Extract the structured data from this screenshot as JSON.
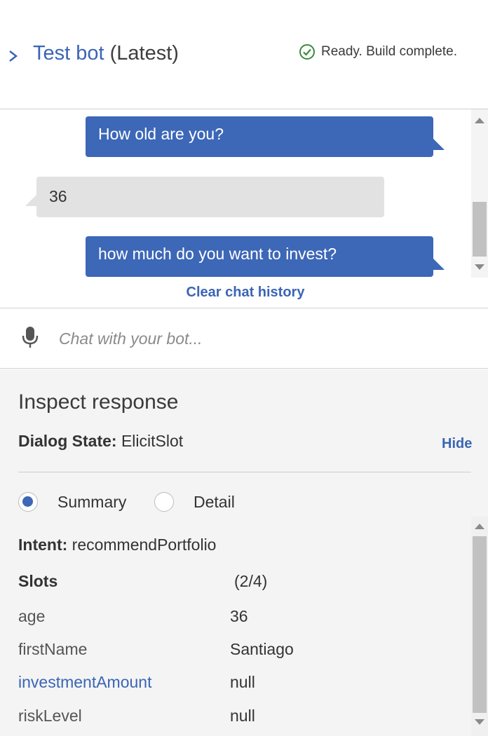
{
  "header": {
    "title_link": "Test bot",
    "title_suffix": "(Latest)",
    "status": "Ready. Build complete.",
    "status_color": "#3c8a3c"
  },
  "chat": {
    "messages": [
      {
        "from": "bot",
        "text": "How old are you?"
      },
      {
        "from": "user",
        "text": "36"
      },
      {
        "from": "bot",
        "text": "how much do you want to invest?"
      }
    ],
    "clear_label": "Clear chat history"
  },
  "input": {
    "placeholder": "Chat with your bot...",
    "icon": "microphone-icon"
  },
  "inspect": {
    "title": "Inspect response",
    "dialog_state_label": "Dialog State:",
    "dialog_state_value": "ElicitSlot",
    "hide_label": "Hide",
    "view_options": [
      {
        "label": "Summary",
        "selected": true
      },
      {
        "label": "Detail",
        "selected": false
      }
    ],
    "intent_label": "Intent:",
    "intent_value": "recommendPortfolio",
    "slots_label": "Slots",
    "slots_count": "(2/4)",
    "slots": [
      {
        "name": "age",
        "value": "36"
      },
      {
        "name": "firstName",
        "value": "Santiago"
      },
      {
        "name": "investmentAmount",
        "value": "null",
        "highlighted": true
      },
      {
        "name": "riskLevel",
        "value": "null"
      }
    ]
  },
  "colors": {
    "accent": "#3d67b7",
    "bot_bubble": "#3d67b7",
    "user_bubble": "#e2e2e2",
    "panel_bg": "#f4f4f4"
  }
}
